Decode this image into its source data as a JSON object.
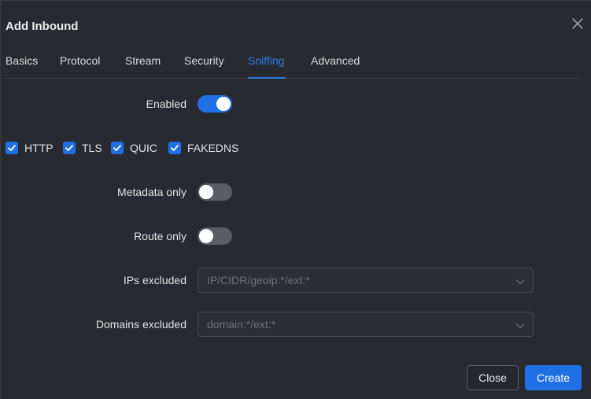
{
  "modal": {
    "title": "Add Inbound",
    "close_icon": "close-icon"
  },
  "tabs": [
    {
      "label": "Basics",
      "active": false
    },
    {
      "label": "Protocol",
      "active": false
    },
    {
      "label": "Stream",
      "active": false
    },
    {
      "label": "Security",
      "active": false
    },
    {
      "label": "Sniffing",
      "active": true
    },
    {
      "label": "Advanced",
      "active": false
    }
  ],
  "sniffing": {
    "enabled": {
      "label": "Enabled",
      "value": true
    },
    "protocols": [
      {
        "label": "HTTP",
        "checked": true
      },
      {
        "label": "TLS",
        "checked": true
      },
      {
        "label": "QUIC",
        "checked": true
      },
      {
        "label": "FAKEDNS",
        "checked": true
      }
    ],
    "metadata_only": {
      "label": "Metadata only",
      "value": false
    },
    "route_only": {
      "label": "Route only",
      "value": false
    },
    "ips_excluded": {
      "label": "IPs excluded",
      "placeholder": "IP/CIDR/geoip:*/ext:*",
      "value": ""
    },
    "domains_excluded": {
      "label": "Domains excluded",
      "placeholder": "domain:*/ext:*",
      "value": ""
    }
  },
  "footer": {
    "close_label": "Close",
    "create_label": "Create"
  },
  "colors": {
    "accent": "#1f6fe5",
    "active_tab": "#2f7de1",
    "background": "#272a31"
  }
}
